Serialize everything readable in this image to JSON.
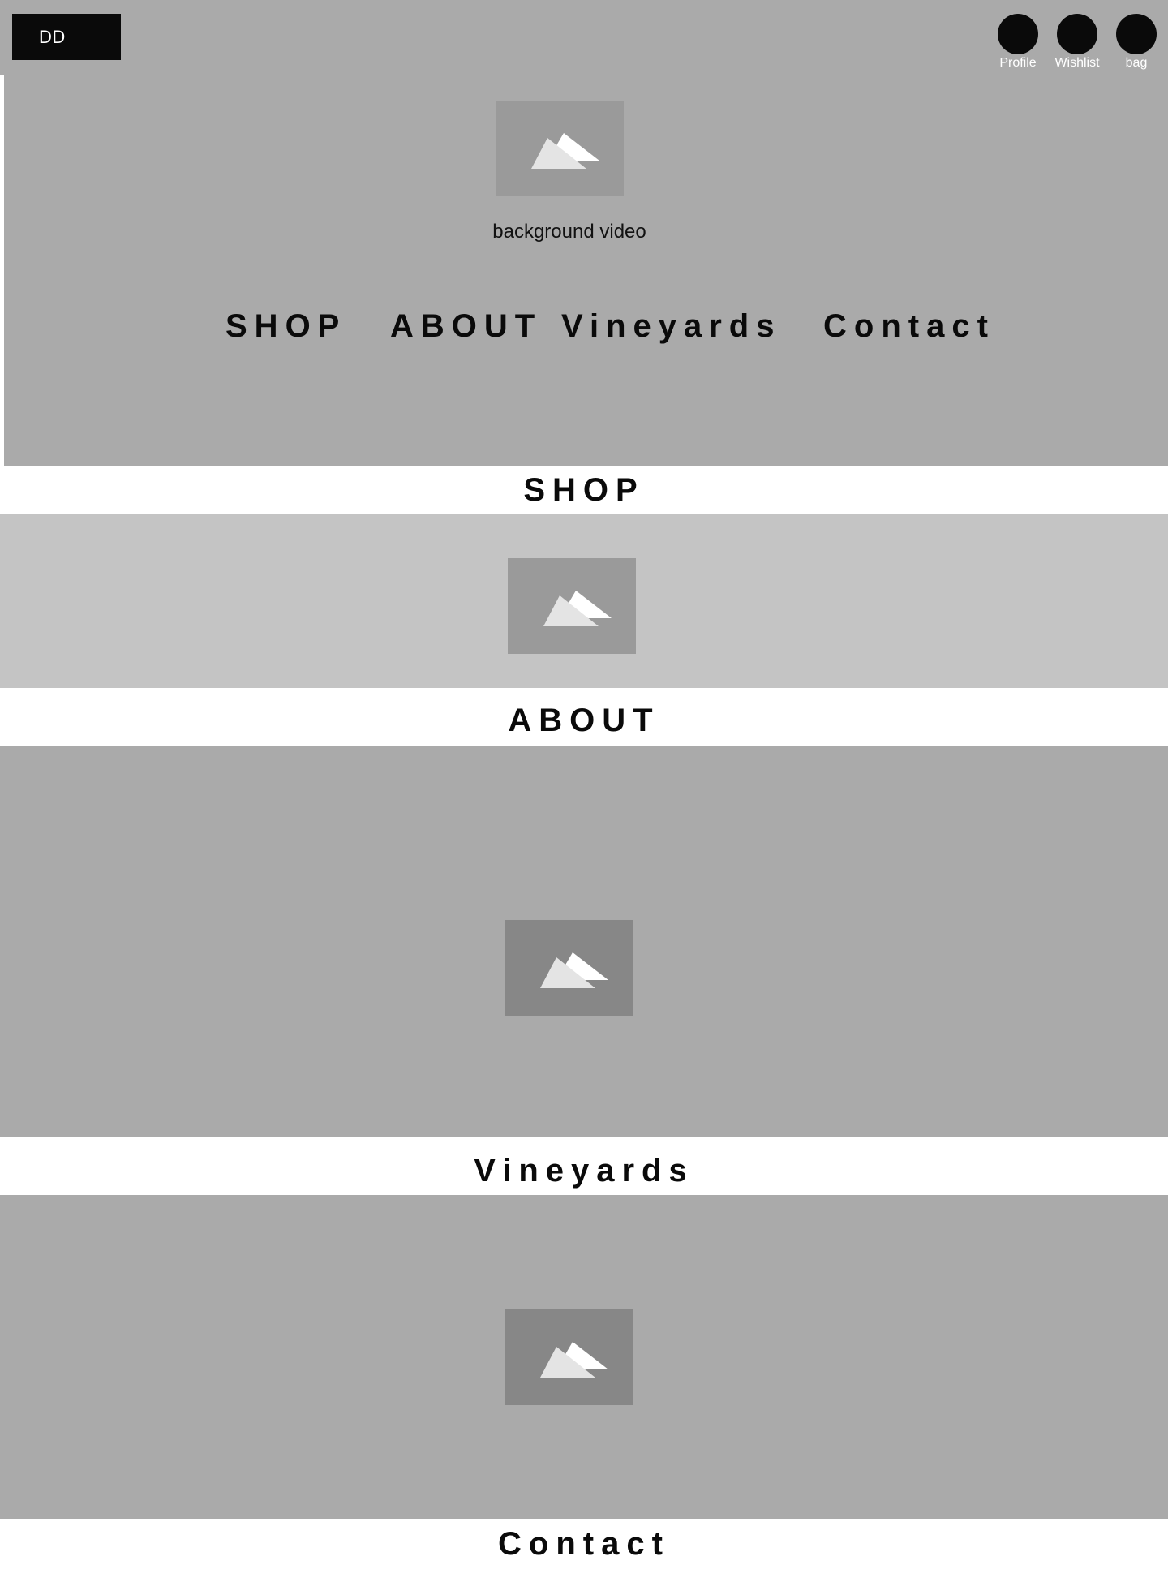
{
  "header": {
    "logo": "DD",
    "icons": [
      {
        "name": "profile-icon",
        "label": "Profile"
      },
      {
        "name": "wishlist-icon",
        "label": "Wishlist"
      },
      {
        "name": "bag-icon",
        "label": "bag"
      }
    ]
  },
  "hero": {
    "caption": "background video",
    "nav": [
      "SHOP",
      "ABOUT",
      "Vineyards",
      "Contact"
    ]
  },
  "sections": [
    {
      "heading": "SHOP"
    },
    {
      "heading": "ABOUT"
    },
    {
      "heading": "Vineyards"
    },
    {
      "heading": "Contact"
    }
  ],
  "icons": {
    "placeholder": "image-placeholder-icon"
  },
  "colors": {
    "hero_bg": "#aaaaaa",
    "shop_bg": "#c4c4c4",
    "section_bg": "#aaaaaa",
    "placeholder": "#9a9a9a",
    "placeholder_dark": "#878787",
    "logo_bg": "#0a0a0a",
    "icon": "#0a0a0a"
  }
}
